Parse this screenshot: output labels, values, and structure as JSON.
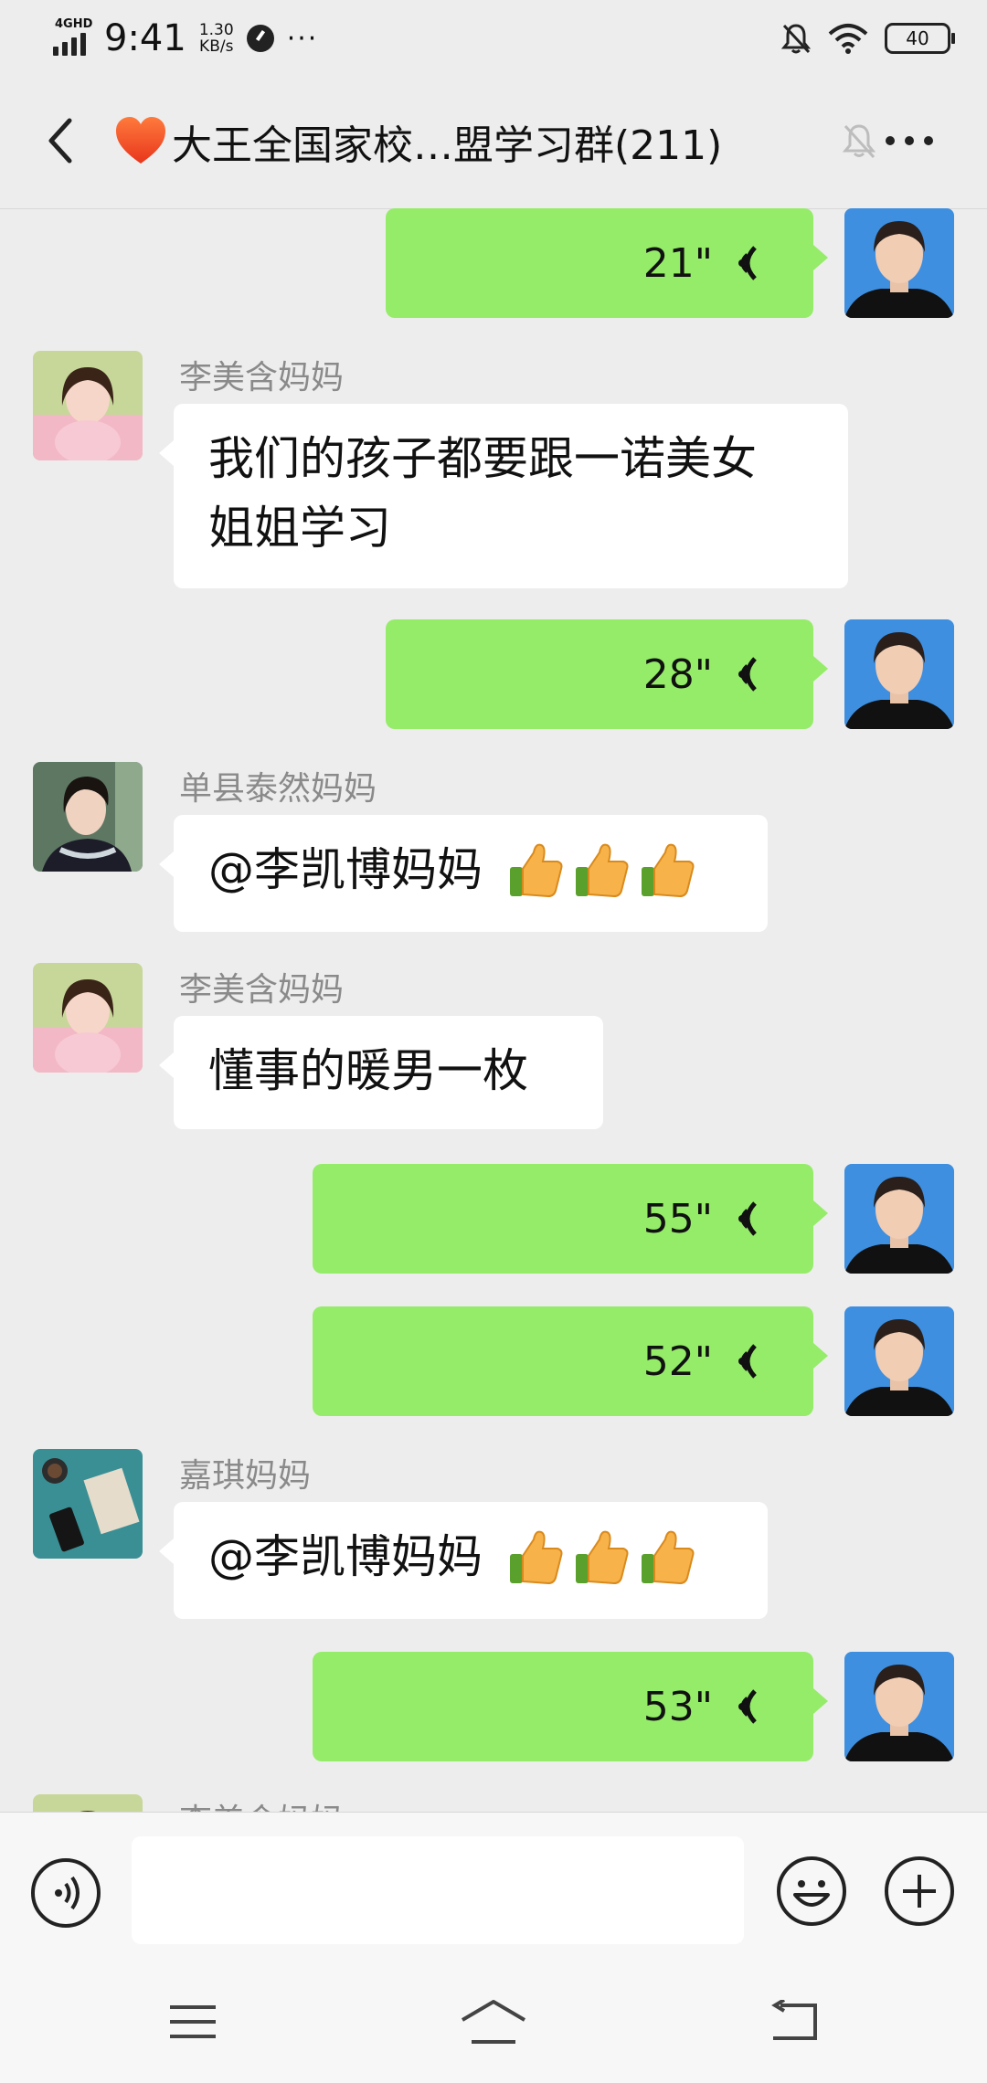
{
  "status_bar": {
    "network": "4GHD",
    "time": "9:41",
    "speed_value": "1.30",
    "speed_unit": "KB/s",
    "more": "···",
    "battery": "40",
    "icons": [
      "signal-icon",
      "status-app-icon",
      "bell-off-icon",
      "wifi-icon",
      "battery-icon"
    ]
  },
  "header": {
    "title": "大王全国家校…盟学习群(211)",
    "icons": [
      "back-icon",
      "heart-icon",
      "mute-icon",
      "more-icon"
    ]
  },
  "messages": [
    {
      "side": "right",
      "type": "voice",
      "duration": "21\""
    },
    {
      "side": "left",
      "sender": "李美含妈妈",
      "lines": [
        "我们的孩子都要跟一诺美女",
        "姐姐学习"
      ]
    },
    {
      "side": "right",
      "type": "voice",
      "duration": "28\""
    },
    {
      "side": "left",
      "sender": "单县泰然妈妈",
      "text": "@李凯博妈妈",
      "emoji": "thumbs-up x3"
    },
    {
      "side": "left",
      "sender": "李美含妈妈",
      "text": "懂事的暖男一枚"
    },
    {
      "side": "right",
      "type": "voice",
      "duration": "55\""
    },
    {
      "side": "right",
      "type": "voice",
      "duration": "52\""
    },
    {
      "side": "left",
      "sender": "嘉琪妈妈",
      "text": "@李凯博妈妈",
      "emoji": "thumbs-up x3"
    },
    {
      "side": "right",
      "type": "voice",
      "duration": "53\""
    },
    {
      "side": "left",
      "sender": "李美含妈妈",
      "partial": true
    }
  ],
  "input_bar": {
    "field_value": "",
    "icons": [
      "voice-input-icon",
      "emoji-icon",
      "plus-icon"
    ]
  },
  "system_nav": {
    "icons": [
      "menu-icon",
      "home-icon",
      "back-nav-icon"
    ]
  },
  "colors": {
    "background": "#ededed",
    "bubble_outgoing": "#95ec69",
    "bubble_incoming": "#ffffff",
    "sender_name": "#8a8a8a"
  }
}
